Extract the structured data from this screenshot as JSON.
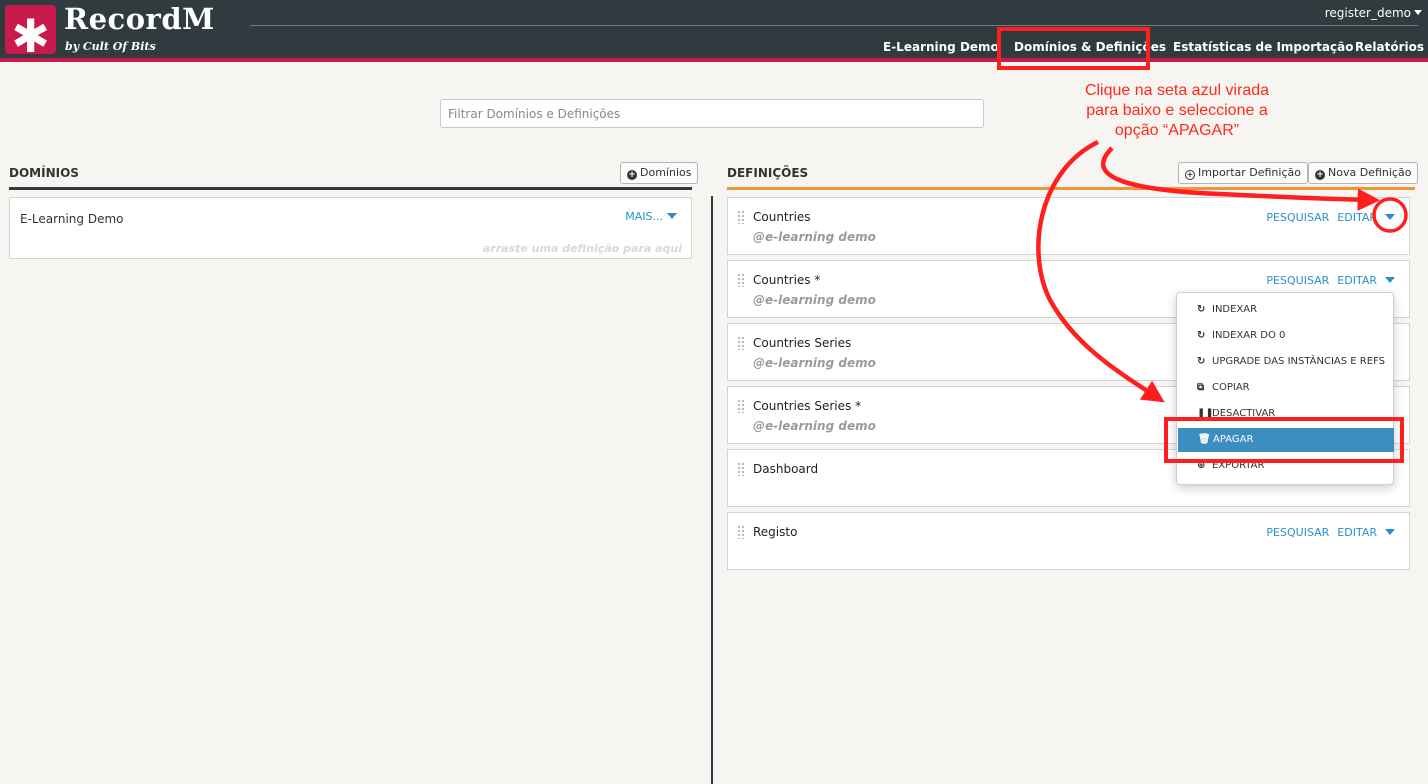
{
  "header": {
    "brand_title": "RecordM",
    "brand_subtitle": "by Cult Of Bits",
    "user": "register_demo",
    "nav": [
      "E-Learning Demo",
      "Domínios & Definições",
      "Estatísticas de Importação",
      "Relatórios"
    ]
  },
  "filter": {
    "placeholder": "Filtrar Domínios e Definições",
    "value": ""
  },
  "domains": {
    "title": "DOMÍNIOS",
    "add_button": "Domínios",
    "items": [
      {
        "name": "E-Learning Demo",
        "more": "MAIS...",
        "hint": "arraste uma definição para aqui"
      }
    ]
  },
  "definitions": {
    "title": "DEFINIÇÕES",
    "import_button": "Importar Definição",
    "new_button": "Nova Definição",
    "search_label": "PESQUISAR",
    "edit_label": "EDITAR",
    "items": [
      {
        "name": "Countries",
        "domain": "@e-learning demo"
      },
      {
        "name": "Countries *",
        "domain": "@e-learning demo"
      },
      {
        "name": "Countries Series",
        "domain": "@e-learning demo"
      },
      {
        "name": "Countries Series *",
        "domain": "@e-learning demo"
      },
      {
        "name": "Dashboard",
        "domain": ""
      },
      {
        "name": "Registo",
        "domain": ""
      }
    ]
  },
  "dropdown": {
    "items": [
      {
        "label": "INDEXAR",
        "icon": "refresh-icon"
      },
      {
        "label": "INDEXAR DO 0",
        "icon": "refresh-icon"
      },
      {
        "label": "UPGRADE DAS INSTÂNCIAS E REFS",
        "icon": "refresh-icon"
      },
      {
        "label": "COPIAR",
        "icon": "copy-icon"
      },
      {
        "label": "DESACTIVAR",
        "icon": "pause-icon"
      },
      {
        "label": "APAGAR",
        "icon": "trash-icon",
        "active": true
      },
      {
        "label": "EXPORTAR",
        "icon": "export-icon"
      }
    ]
  },
  "annotation": {
    "lines": [
      "Clique na seta azul virada",
      "para baixo e seleccione a",
      "opção “APAGAR”"
    ]
  },
  "colors": {
    "header_bg": "#2f3b3f",
    "brand_accent": "#c81a4c",
    "link_blue": "#2a8fce",
    "definitions_accent": "#f0963a",
    "annotation_red": "#ff1f1f",
    "active_item": "#3c8dc0"
  }
}
